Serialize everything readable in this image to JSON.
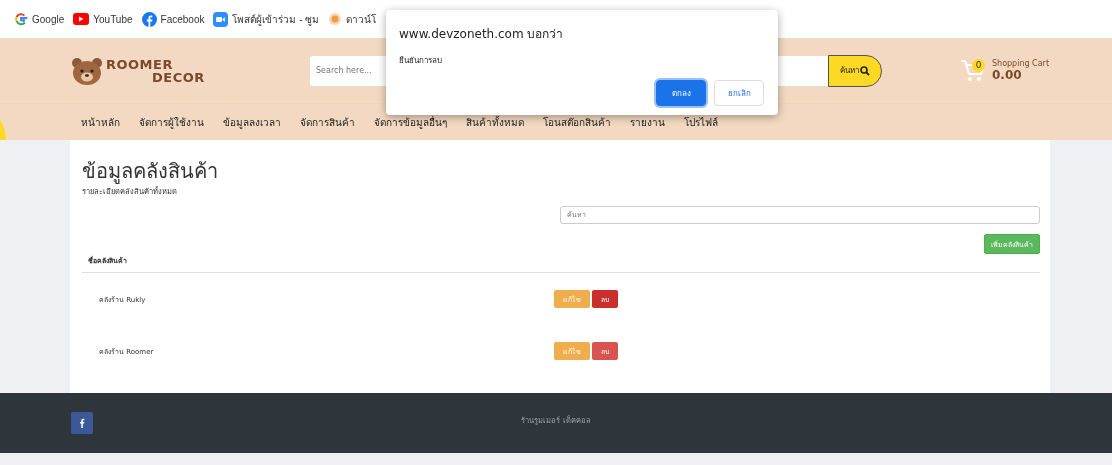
{
  "bookmarks": [
    {
      "label": "Google"
    },
    {
      "label": "YouTube"
    },
    {
      "label": "Facebook"
    },
    {
      "label": "โพสต์ผู้เข้าร่วม - ซูม"
    },
    {
      "label": "ดาวน์โ"
    }
  ],
  "header": {
    "logo_line_1": "ROOMER",
    "logo_line_2": "DECOR",
    "search": {
      "placeholder": "Search here...",
      "button": "ค้นหา"
    },
    "cart": {
      "count": "0",
      "label": "Shopping Cart",
      "total": "0.00"
    }
  },
  "nav": [
    "หน้าหลัก",
    "จัดการผู้ใช้งาน",
    "ข้อมูลลงเวลา",
    "จัดการสินค้า",
    "จัดการข้อมูลอื่นๆ",
    "สินค้าทั้งหมด",
    "โอนสต๊อกสินค้า",
    "รายงาน",
    "โปรไฟล์"
  ],
  "page": {
    "title": "ข้อมูลคลังสินค้า",
    "subtitle": "รายละเอียดคลังสินค้าทั้งหมด",
    "search": {
      "placeholder": "ค้นหา"
    },
    "add_button": "เพิ่มคลังสินค้า",
    "table": {
      "columns": [
        "ชื่อคลังสินค้า"
      ],
      "rows": [
        {
          "prefix": "คลังร้าน",
          "name": "Rukly",
          "edit": "แก้ไข",
          "delete": "ลบ",
          "delete_hovered": true
        },
        {
          "prefix": "คลังร้าน",
          "name": "Roomer",
          "edit": "แก้ไข",
          "delete": "ลบ",
          "delete_hovered": false
        }
      ]
    }
  },
  "footer": {
    "text": "ร้านรูมเมอร์ เด็คคอล"
  },
  "dialog": {
    "title": "www.devzoneth.com บอกว่า",
    "message": "ยืนยันการลบ",
    "ok": "ตกลง",
    "cancel": "ยกเลิก"
  }
}
